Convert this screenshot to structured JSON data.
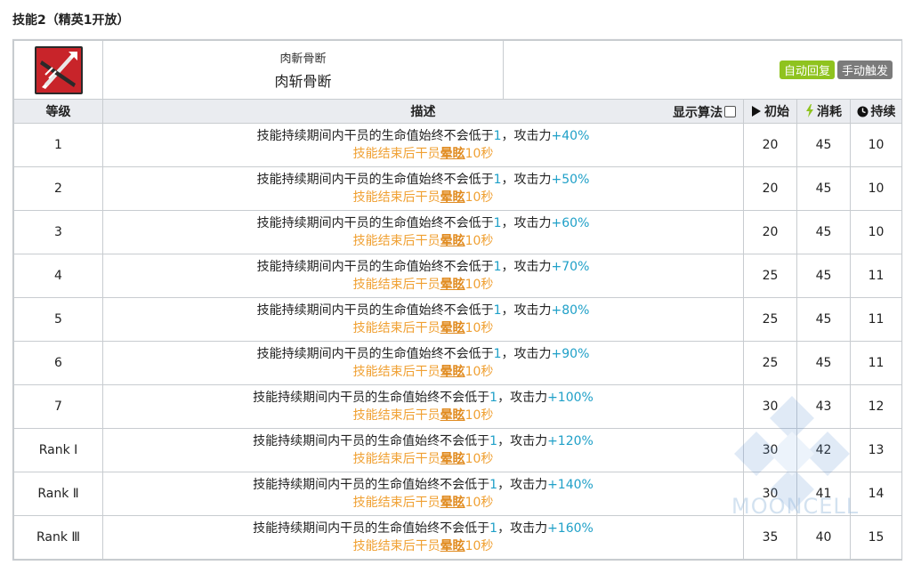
{
  "page": {
    "title": "技能2（精英1开放）"
  },
  "skill": {
    "name_jp": "肉斬骨断",
    "name_cn": "肉斩骨断",
    "tags": [
      "自动回复",
      "手动触发"
    ],
    "icon": "crossed-blades-icon"
  },
  "table": {
    "headers": {
      "level": "等级",
      "desc": "描述",
      "formula_toggle": "显示算法",
      "initial": "初始",
      "cost": "消耗",
      "duration": "持续"
    },
    "rows": [
      {
        "level": "1",
        "line1_pre": "技能持续期间内干员的生命值始终不会低于",
        "hp": "1",
        "line1_mid": "，攻击力",
        "atk": "+40%",
        "line2_pre": "技能结束后干员",
        "stun": "晕眩",
        "line2_post": "10秒",
        "initial": "20",
        "cost": "45",
        "duration": "10"
      },
      {
        "level": "2",
        "line1_pre": "技能持续期间内干员的生命值始终不会低于",
        "hp": "1",
        "line1_mid": "，攻击力",
        "atk": "+50%",
        "line2_pre": "技能结束后干员",
        "stun": "晕眩",
        "line2_post": "10秒",
        "initial": "20",
        "cost": "45",
        "duration": "10"
      },
      {
        "level": "3",
        "line1_pre": "技能持续期间内干员的生命值始终不会低于",
        "hp": "1",
        "line1_mid": "，攻击力",
        "atk": "+60%",
        "line2_pre": "技能结束后干员",
        "stun": "晕眩",
        "line2_post": "10秒",
        "initial": "20",
        "cost": "45",
        "duration": "10"
      },
      {
        "level": "4",
        "line1_pre": "技能持续期间内干员的生命值始终不会低于",
        "hp": "1",
        "line1_mid": "，攻击力",
        "atk": "+70%",
        "line2_pre": "技能结束后干员",
        "stun": "晕眩",
        "line2_post": "10秒",
        "initial": "25",
        "cost": "45",
        "duration": "11"
      },
      {
        "level": "5",
        "line1_pre": "技能持续期间内干员的生命值始终不会低于",
        "hp": "1",
        "line1_mid": "，攻击力",
        "atk": "+80%",
        "line2_pre": "技能结束后干员",
        "stun": "晕眩",
        "line2_post": "10秒",
        "initial": "25",
        "cost": "45",
        "duration": "11"
      },
      {
        "level": "6",
        "line1_pre": "技能持续期间内干员的生命值始终不会低于",
        "hp": "1",
        "line1_mid": "，攻击力",
        "atk": "+90%",
        "line2_pre": "技能结束后干员",
        "stun": "晕眩",
        "line2_post": "10秒",
        "initial": "25",
        "cost": "45",
        "duration": "11"
      },
      {
        "level": "7",
        "line1_pre": "技能持续期间内干员的生命值始终不会低于",
        "hp": "1",
        "line1_mid": "，攻击力",
        "atk": "+100%",
        "line2_pre": "技能结束后干员",
        "stun": "晕眩",
        "line2_post": "10秒",
        "initial": "30",
        "cost": "43",
        "duration": "12"
      },
      {
        "level": "Rank Ⅰ",
        "line1_pre": "技能持续期间内干员的生命值始终不会低于",
        "hp": "1",
        "line1_mid": "，攻击力",
        "atk": "+120%",
        "line2_pre": "技能结束后干员",
        "stun": "晕眩",
        "line2_post": "10秒",
        "initial": "30",
        "cost": "42",
        "duration": "13"
      },
      {
        "level": "Rank Ⅱ",
        "line1_pre": "技能持续期间内干员的生命值始终不会低于",
        "hp": "1",
        "line1_mid": "，攻击力",
        "atk": "+140%",
        "line2_pre": "技能结束后干员",
        "stun": "晕眩",
        "line2_post": "10秒",
        "initial": "30",
        "cost": "41",
        "duration": "14"
      },
      {
        "level": "Rank Ⅲ",
        "line1_pre": "技能持续期间内干员的生命值始终不会低于",
        "hp": "1",
        "line1_mid": "，攻击力",
        "atk": "+160%",
        "line2_pre": "技能结束后干员",
        "stun": "晕眩",
        "line2_post": "10秒",
        "initial": "35",
        "cost": "40",
        "duration": "15"
      }
    ]
  },
  "watermark": {
    "text": "MOONCELL"
  },
  "colors": {
    "tag_auto": "#8fc31f",
    "tag_manual": "#7b7b7b",
    "highlight_blue": "#1fa0c8",
    "highlight_orange": "#f0a032",
    "cost_icon": "#8fc31f"
  }
}
